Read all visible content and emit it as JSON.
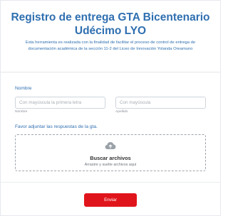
{
  "header": {
    "title": "Registro de entrega GTA Bicentenario Udécimo LYO",
    "description": "Esta herramienta es realizada con la finalidad de facilitar el proceso de control de entrega de documentación académica de la sección 11-2 del Liceo de Innovación Yolanda Oreamuno"
  },
  "form": {
    "name_section_label": "Nombre",
    "first_name": {
      "placeholder": "Con mayúscula la primera letra",
      "value": "",
      "sublabel": "Nombre"
    },
    "last_name": {
      "placeholder": "Con mayúscula",
      "value": "",
      "sublabel": "Apellido"
    },
    "attach_label": "Favor adjuntar las respuestas de la gta.",
    "upload": {
      "icon": "cloud-upload-icon",
      "title": "Buscar archivos",
      "subtitle": "Arrastre y suelte archivos aquí"
    },
    "submit_label": "Enviar"
  },
  "colors": {
    "accent": "#2f6fb0",
    "submit": "#e0151b"
  }
}
